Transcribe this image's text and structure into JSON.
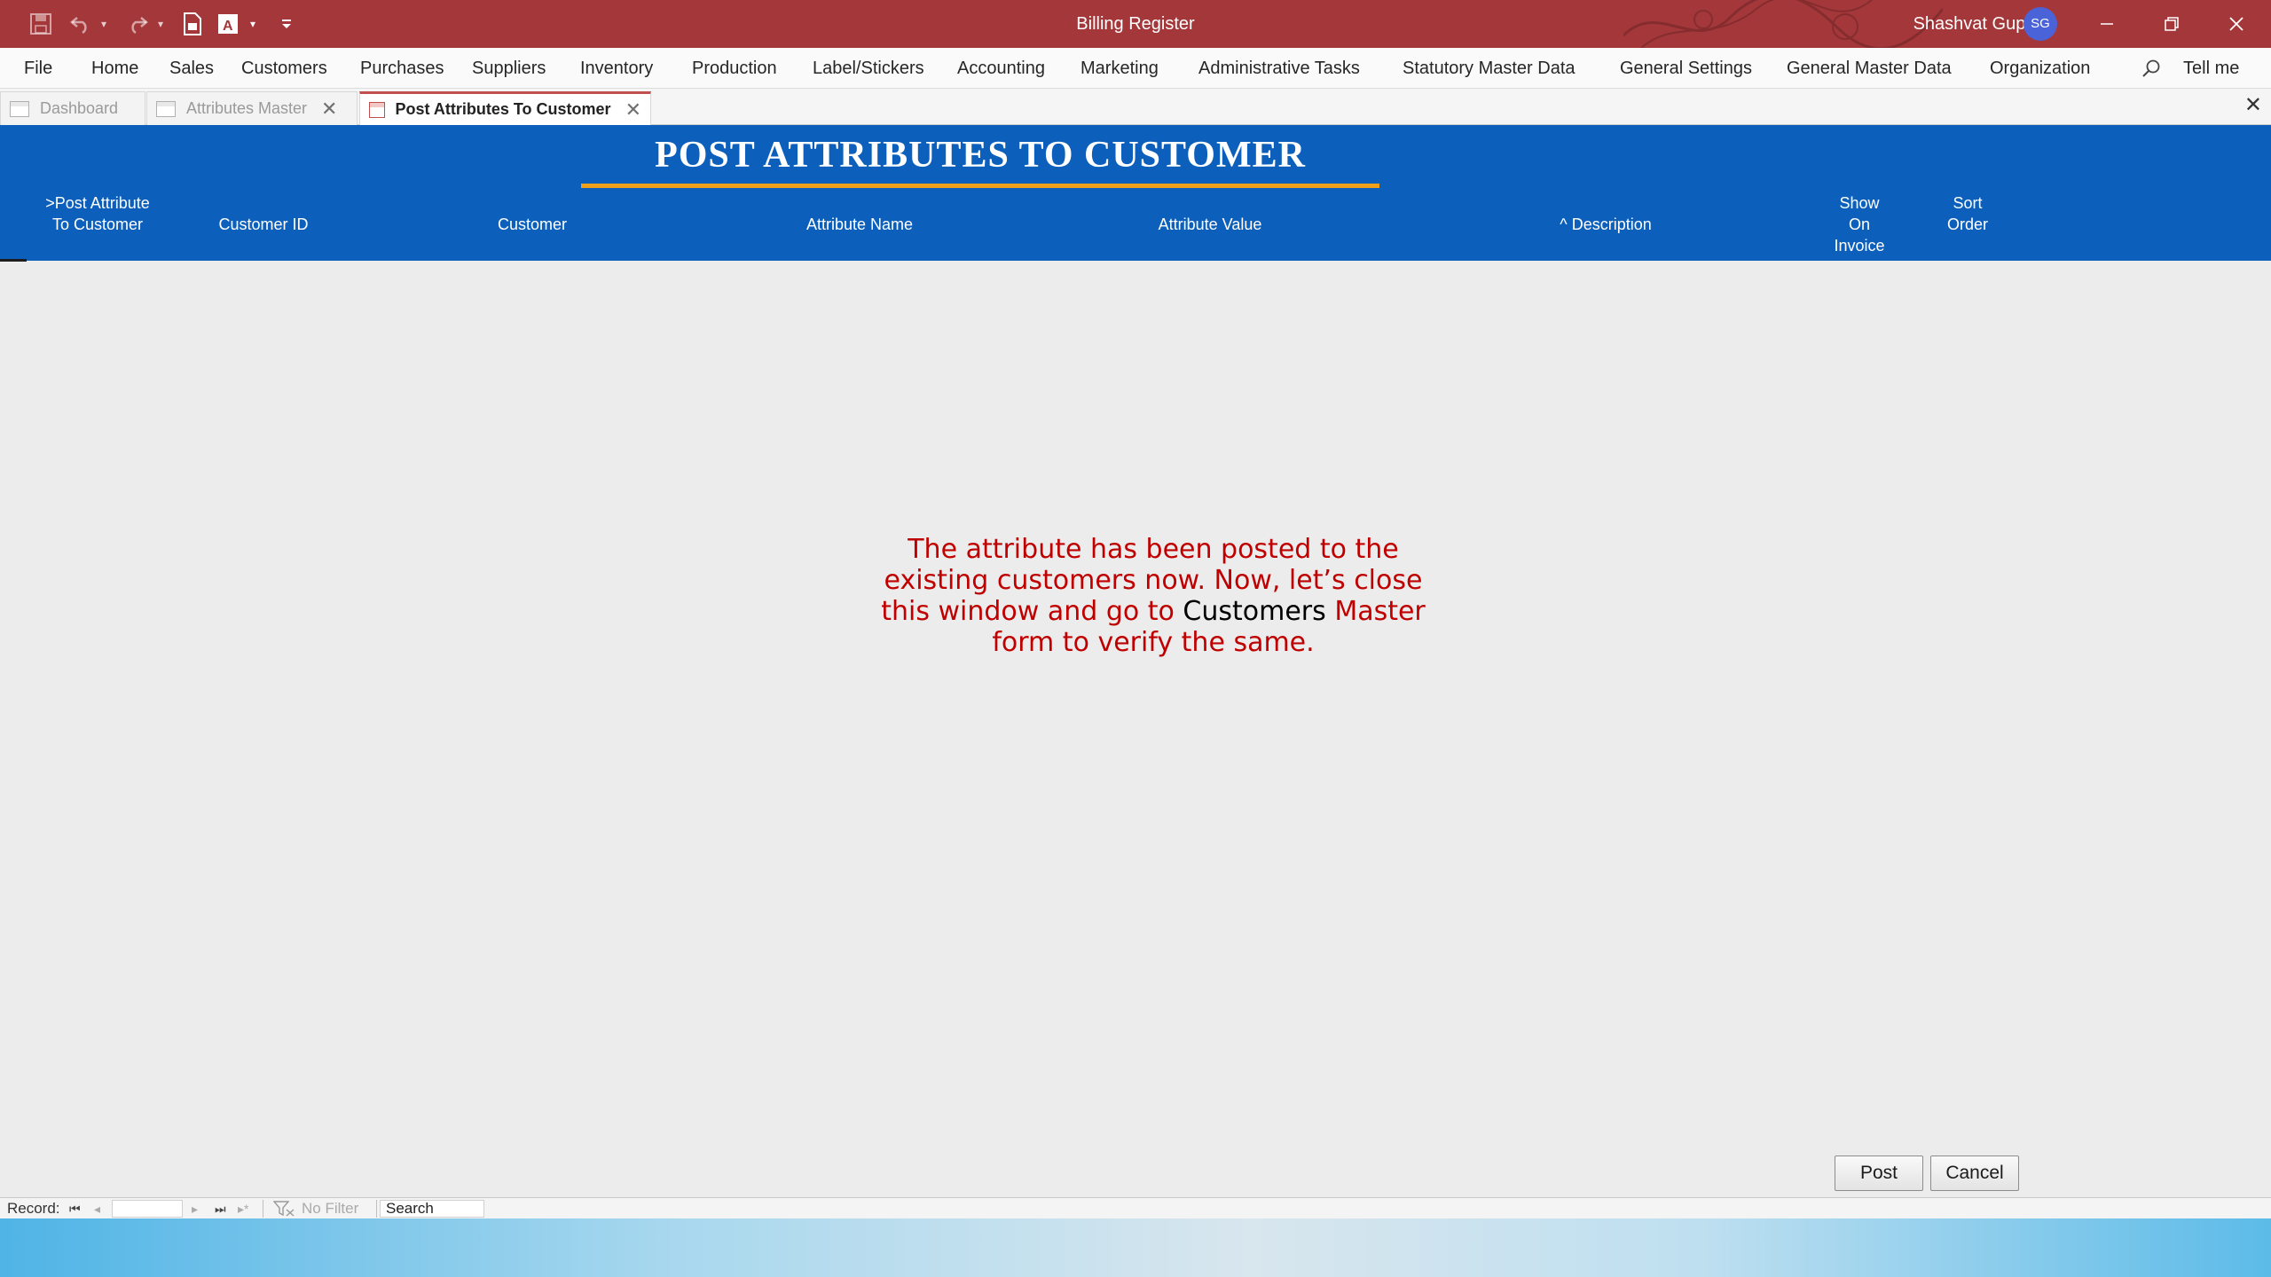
{
  "titlebar": {
    "app_title": "Billing Register",
    "user_name": "Shashvat Gupta",
    "user_initials": "SG",
    "quick_access_icons": [
      "save-icon",
      "undo-icon",
      "redo-icon",
      "new-document-icon",
      "form-view-icon",
      "customize-toolbar-icon"
    ],
    "window_controls": [
      "minimize",
      "restore",
      "close"
    ],
    "color": "#a4373a"
  },
  "menu": {
    "items": [
      "File",
      "Home",
      "Sales",
      "Customers",
      "Purchases",
      "Suppliers",
      "Inventory",
      "Production",
      "Label/Stickers",
      "Accounting",
      "Marketing",
      "Administrative Tasks",
      "Statutory Master Data",
      "General Settings",
      "General Master Data",
      "Organization"
    ],
    "tell_me": "Tell me"
  },
  "tabs": [
    {
      "label": "Dashboard",
      "active": false,
      "closable": false
    },
    {
      "label": "Attributes Master",
      "active": false,
      "closable": true
    },
    {
      "label": "Post Attributes To Customer",
      "active": true,
      "closable": true
    }
  ],
  "form": {
    "title": "POST ATTRIBUTES TO CUSTOMER",
    "header_color": "#0c60bc",
    "accent_color": "#f0a019",
    "columns": {
      "post_attribute_line1": ">Post Attribute",
      "post_attribute_line2": "To Customer",
      "customer_id": "Customer ID",
      "customer": "Customer",
      "attribute_name": "Attribute Name",
      "attribute_value": "Attribute Value",
      "description": "^ Description",
      "show_on_invoice_line1": "Show",
      "show_on_invoice_line2": "On",
      "show_on_invoice_line3": "Invoice",
      "sort_order_line1": "Sort",
      "sort_order_line2": "Order"
    }
  },
  "annotation": {
    "line1": "The attribute has been posted to the",
    "line2": "existing customers now. Now, let’s close",
    "line3_before": "this window and go to ",
    "line3_highlight": "Customers",
    "line3_after": " Master",
    "line4": "form to verify the same.",
    "color": "#c00000"
  },
  "buttons": {
    "post": "Post",
    "cancel": "Cancel"
  },
  "record_nav": {
    "label": "Record:",
    "first": "⏮",
    "prev": "◂",
    "next": "▸",
    "last": "⏭",
    "new": "▸*",
    "filter": "No Filter",
    "search": "Search"
  }
}
